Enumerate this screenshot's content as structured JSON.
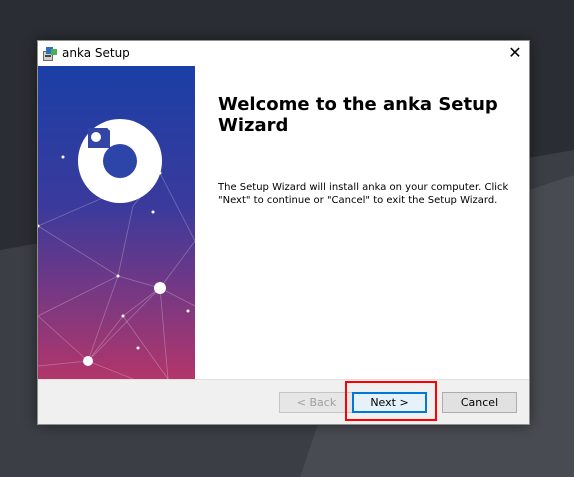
{
  "window": {
    "title": "anka Setup",
    "close_glyph": "✕",
    "app_icon": "installer-icon"
  },
  "main": {
    "heading": "Welcome to the anka Setup Wizard",
    "description": "The Setup Wizard will install anka on your computer.  Click \"Next\" to continue or \"Cancel\" to exit the Setup Wizard."
  },
  "footer": {
    "back_label": "< Back",
    "next_label": "Next >",
    "cancel_label": "Cancel"
  },
  "colors": {
    "banner_top": "#1a3fa6",
    "banner_bottom": "#b2366a",
    "highlight": "#ff0000",
    "accent": "#0078d7"
  }
}
